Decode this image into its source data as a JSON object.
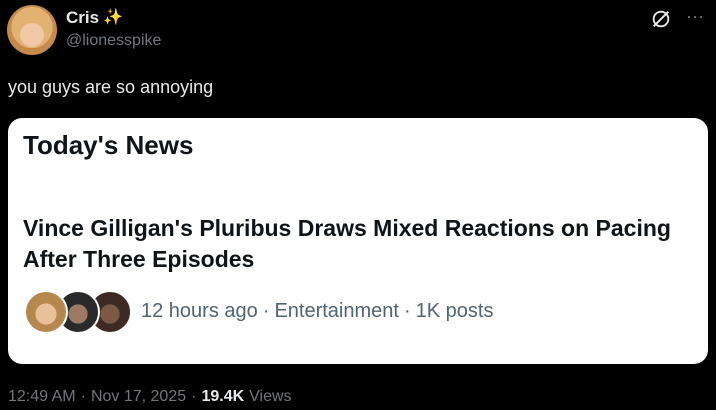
{
  "author": {
    "display_name": "Cris",
    "emoji": "✨",
    "handle": "@lionesspike"
  },
  "tweet": {
    "text": "you guys are so annoying"
  },
  "card": {
    "heading": "Today's News",
    "headline": "Vince Gilligan's Pluribus Draws Mixed Reactions on Pacing After Three Episodes",
    "time_ago": "12 hours ago",
    "category": "Entertainment",
    "posts": "1K posts",
    "separator": "·"
  },
  "meta": {
    "time": "12:49 AM",
    "date": "Nov 17, 2025",
    "views_count": "19.4K",
    "views_label": "Views",
    "separator": "·"
  },
  "icons": {
    "grok": "grok-icon",
    "more": "more-icon"
  },
  "colors": {
    "background": "#000000",
    "text_primary": "#e7e9ea",
    "text_secondary": "#71767b",
    "card_background": "#ffffff",
    "card_text": "#0f1419",
    "card_meta": "#536471",
    "sparkle": "#f7c948"
  }
}
